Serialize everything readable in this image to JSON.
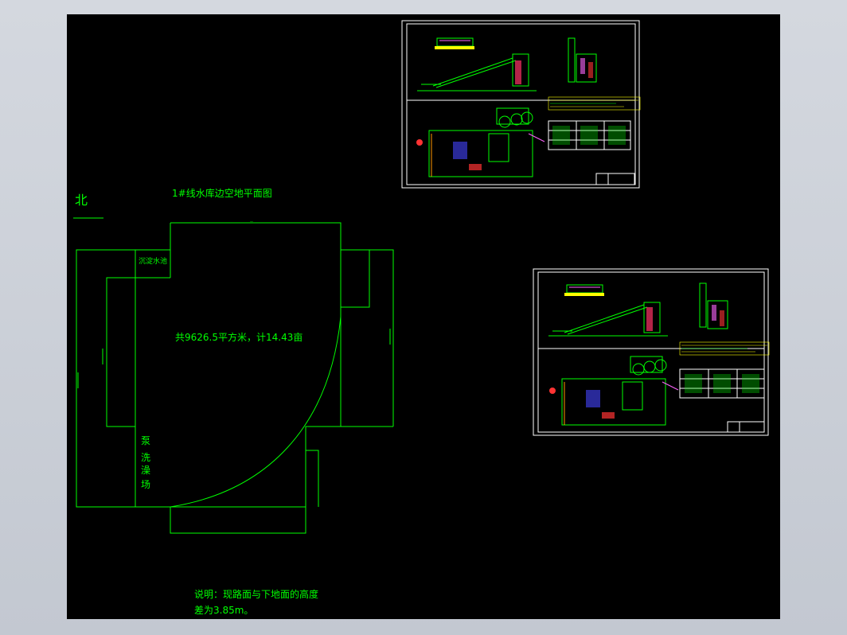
{
  "drawing": {
    "north_label": "北",
    "plan_title": "1#线水库边空地平面图",
    "area_text": "共9626.5平方米，计14.43亩",
    "pool_label": "沉淀水池",
    "pump_label_chars": [
      "泵",
      "洗",
      "澡",
      "场"
    ],
    "note_line1": "说明：现路面与下地面的高度",
    "note_line2": "差为3.85m。"
  },
  "colors": {
    "background": "#000000",
    "line": "#00ff00",
    "frame": "#ffffff",
    "viewer": "#c8cdd5"
  }
}
